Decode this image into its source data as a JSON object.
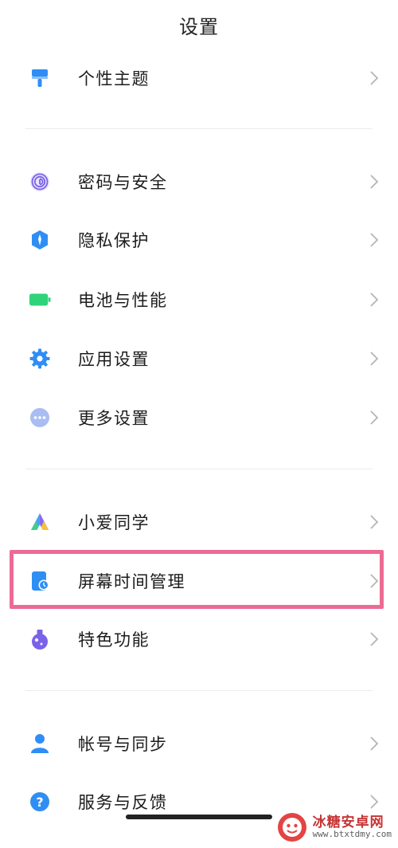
{
  "header": {
    "title": "设置"
  },
  "items": [
    {
      "id": "theme",
      "label": "个性主题",
      "icon": "paint-brush-icon"
    },
    {
      "id": "password-security",
      "label": "密码与安全",
      "icon": "fingerprint-icon"
    },
    {
      "id": "privacy",
      "label": "隐私保护",
      "icon": "privacy-shield-icon"
    },
    {
      "id": "battery",
      "label": "电池与性能",
      "icon": "battery-icon"
    },
    {
      "id": "app-settings",
      "label": "应用设置",
      "icon": "gear-icon"
    },
    {
      "id": "more-settings",
      "label": "更多设置",
      "icon": "more-dots-icon"
    },
    {
      "id": "xiaoai",
      "label": "小爱同学",
      "icon": "xiaoai-icon"
    },
    {
      "id": "screen-time",
      "label": "屏幕时间管理",
      "icon": "screen-time-icon"
    },
    {
      "id": "special-features",
      "label": "特色功能",
      "icon": "flask-icon"
    },
    {
      "id": "account-sync",
      "label": "帐号与同步",
      "icon": "person-icon"
    },
    {
      "id": "service-feedback",
      "label": "服务与反馈",
      "icon": "question-icon"
    }
  ],
  "highlighted_item": "screen-time",
  "colors": {
    "highlight": "#ec6b94",
    "accent_blue": "#2f8ef4",
    "battery_green": "#2fd47a",
    "purple": "#7a62e8"
  },
  "watermark": {
    "main": "冰糖安卓网",
    "sub": "www.btxtdmy.com"
  }
}
